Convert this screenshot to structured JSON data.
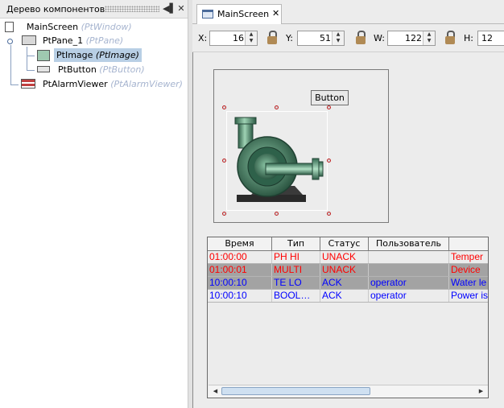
{
  "tree": {
    "title": "Дерево компонентов",
    "nodes": [
      {
        "name": "MainScreen",
        "type": "(PtWindow)"
      },
      {
        "name": "PtPane_1",
        "type": "(PtPane)"
      },
      {
        "name": "PtImage",
        "type": "(PtImage)"
      },
      {
        "name": "PtButton",
        "type": "(PtButton)"
      },
      {
        "name": "PtAlarmViewer",
        "type": "(PtAlarmViewer)"
      }
    ]
  },
  "editor": {
    "tab_label": "MainScreen",
    "tab_close": "✕"
  },
  "coords": {
    "x_label": "X:",
    "x_value": "16",
    "y_label": "Y:",
    "y_value": "51",
    "w_label": "W:",
    "w_value": "122",
    "h_label": "H:",
    "h_value": "12"
  },
  "canvas": {
    "button_label": "Button"
  },
  "alarm": {
    "columns": [
      "Время",
      "Тип",
      "Статус",
      "Пользователь",
      ""
    ],
    "rows": [
      {
        "time": "01:00:00",
        "type": "PH HI",
        "status": "UNACK",
        "user": "",
        "message": "Temper",
        "color": "#ff0000",
        "bg": "#ececec"
      },
      {
        "time": "01:00:01",
        "type": "MULTI",
        "status": "UNACK",
        "user": "",
        "message": "Device",
        "color": "#ff0000",
        "bg": "#a3a3a3"
      },
      {
        "time": "10:00:10",
        "type": "TE LO",
        "status": "ACK",
        "user": "operator",
        "message": "Water le",
        "color": "#0000ff",
        "bg": "#a3a3a3"
      },
      {
        "time": "10:00:10",
        "type": "BOOL…",
        "status": "ACK",
        "user": "operator",
        "message": "Power is",
        "color": "#0000ff",
        "bg": "#ececec"
      }
    ]
  }
}
